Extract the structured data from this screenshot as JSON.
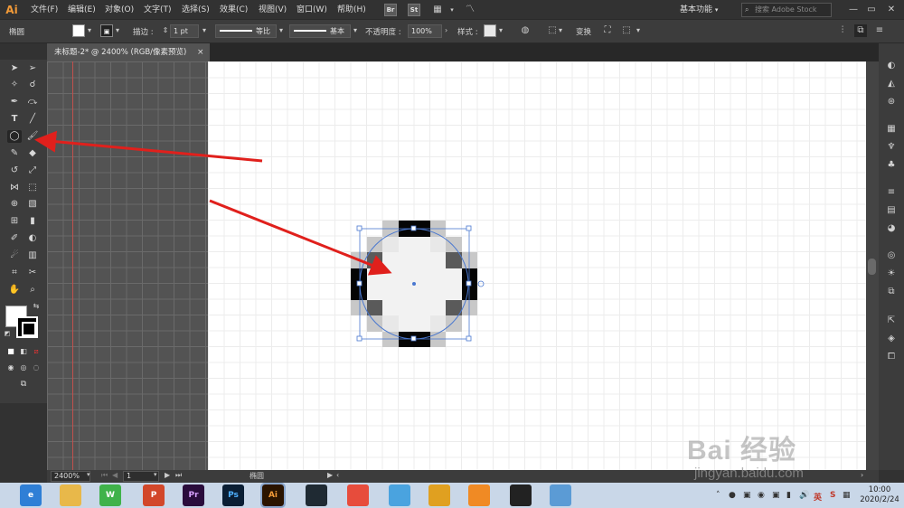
{
  "app": {
    "logo": "Ai",
    "menus": [
      "文件(F)",
      "编辑(E)",
      "对象(O)",
      "文字(T)",
      "选择(S)",
      "效果(C)",
      "视图(V)",
      "窗口(W)",
      "帮助(H)"
    ],
    "bridge_badge": "Br",
    "stock_badge": "St",
    "workspace": "基本功能",
    "search_placeholder": "搜索 Adobe Stock"
  },
  "control_bar": {
    "selection_label": "椭圆",
    "stroke_label": "描边 :",
    "stroke_weight": "1 pt",
    "profile_label": "等比",
    "brush_label": "基本",
    "opacity_label": "不透明度 :",
    "opacity_value": "100%",
    "style_label": "样式 :",
    "transform_label": "变换"
  },
  "document": {
    "tab_title": "未标题-2* @ 2400% (RGB/像素预览)",
    "close_glyph": "×"
  },
  "status_bar": {
    "zoom": "2400%",
    "artboard_number": "1",
    "current_tool": "椭圆"
  },
  "taskbar": {
    "apps": [
      {
        "name": "Edge",
        "label": "e",
        "color": "#2f7fd6"
      },
      {
        "name": "File Explorer",
        "label": "",
        "color": "#e8b84a"
      },
      {
        "name": "WeChat",
        "label": "W",
        "color": "#3fb24a"
      },
      {
        "name": "PowerPoint",
        "label": "P",
        "color": "#d2472a"
      },
      {
        "name": "Premiere",
        "label": "Pr",
        "color": "#2a0c3c"
      },
      {
        "name": "Photoshop",
        "label": "Ps",
        "color": "#0a1e34"
      },
      {
        "name": "Illustrator",
        "label": "Ai",
        "color": "#2a1400"
      },
      {
        "name": "Video",
        "label": "",
        "color": "#1f2a33"
      },
      {
        "name": "Tool",
        "label": "",
        "color": "#e74c3c"
      },
      {
        "name": "Tool2",
        "label": "",
        "color": "#4aa3df"
      },
      {
        "name": "Chrome",
        "label": "",
        "color": "#e0a020"
      },
      {
        "name": "Browser",
        "label": "",
        "color": "#f08a24"
      },
      {
        "name": "QQ",
        "label": "",
        "color": "#222222"
      },
      {
        "name": "Tool3",
        "label": "",
        "color": "#5b9bd5"
      }
    ],
    "ime": "英",
    "time": "10:00",
    "date": "2020/2/24"
  },
  "watermark": {
    "brand": "Bai 经验",
    "url": "jingyan.baidu.com"
  },
  "colors": {
    "accent_ai": "#f29a38",
    "arrow_red": "#e0201c",
    "selection_blue": "#4a78d0"
  },
  "icons": [
    "selection-icon",
    "direct-selection-icon",
    "magic-wand-icon",
    "lasso-icon",
    "pen-icon",
    "curvature-icon",
    "type-icon",
    "line-icon",
    "ellipse-icon",
    "paintbrush-icon",
    "shaper-icon",
    "eraser-icon",
    "rotate-icon",
    "scale-icon",
    "width-icon",
    "free-transform-icon",
    "shape-builder-icon",
    "perspective-icon",
    "mesh-icon",
    "gradient-icon",
    "eyedropper-icon",
    "blend-icon",
    "symbol-sprayer-icon",
    "graph-icon",
    "artboard-icon",
    "slice-icon",
    "hand-icon",
    "zoom-icon"
  ]
}
